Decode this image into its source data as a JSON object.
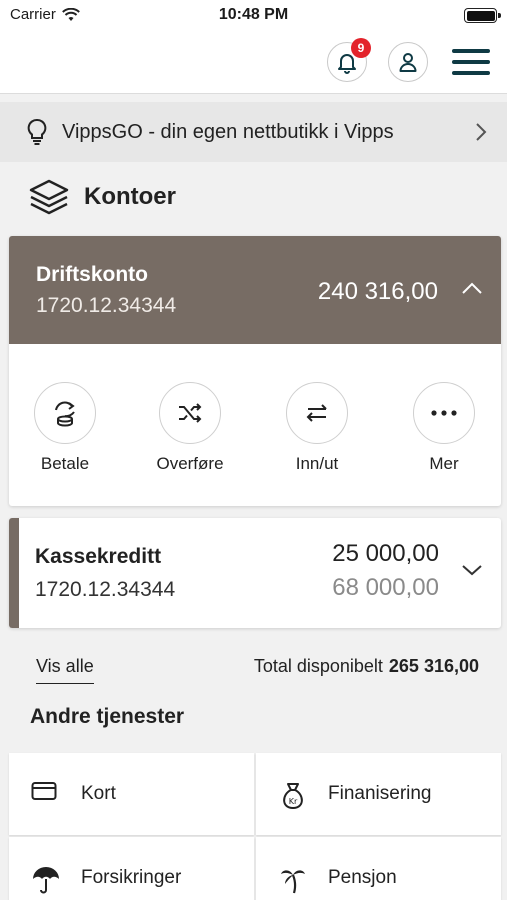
{
  "status_bar": {
    "carrier": "Carrier",
    "time": "10:48 PM"
  },
  "header": {
    "notifications_count": "9"
  },
  "promo": {
    "text": "VippsGO - din egen nettbutikk i Vipps"
  },
  "accounts_section": {
    "title": "Kontoer"
  },
  "main_account": {
    "name": "Driftskonto",
    "number": "1720.12.34344",
    "balance": "240 316,00",
    "actions": [
      {
        "label": "Betale",
        "icon": "pay-icon"
      },
      {
        "label": "Overføre",
        "icon": "transfer-icon"
      },
      {
        "label": "Inn/ut",
        "icon": "in-out-icon"
      },
      {
        "label": "Mer",
        "icon": "more-icon"
      }
    ]
  },
  "credit_account": {
    "name": "Kassekreditt",
    "number": "1720.12.34344",
    "available": "25 000,00",
    "limit": "68 000,00"
  },
  "summary": {
    "show_all": "Vis alle",
    "total_label": "Total disponibelt",
    "total_amount": "265 316,00"
  },
  "other_services": {
    "title": "Andre tjenester",
    "items": [
      {
        "label": "Kort",
        "icon": "card-icon"
      },
      {
        "label": "Finanisering",
        "icon": "money-bag-icon"
      },
      {
        "label": "Forsikringer",
        "icon": "umbrella-icon"
      },
      {
        "label": "Pensjon",
        "icon": "palm-tree-icon"
      }
    ]
  },
  "colors": {
    "account_header": "#776c64",
    "badge": "#e3232b",
    "menu": "#0f3a44",
    "promo_bg": "#e7e7e7"
  }
}
